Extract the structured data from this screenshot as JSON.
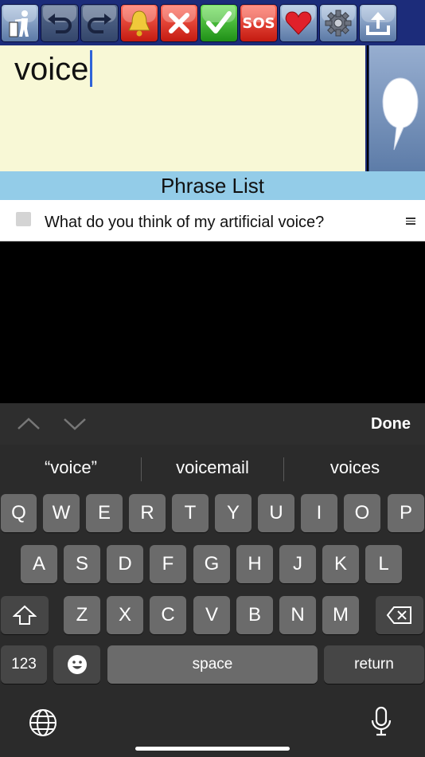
{
  "toolbar": {
    "buttons": [
      {
        "icon": "trash-person-icon"
      },
      {
        "icon": "undo-icon"
      },
      {
        "icon": "redo-icon"
      },
      {
        "icon": "bell-icon"
      },
      {
        "icon": "cancel-x-icon"
      },
      {
        "icon": "checkmark-icon"
      },
      {
        "icon": "sos-icon",
        "label": "SOS"
      },
      {
        "icon": "heart-icon"
      },
      {
        "icon": "gear-icon"
      },
      {
        "icon": "share-upload-icon"
      }
    ]
  },
  "editor": {
    "text": "voice"
  },
  "speak": {
    "icon": "speech-bubble-icon"
  },
  "phrase_list": {
    "title": "Phrase List",
    "items": [
      {
        "text": "What do you think of my artificial voice?"
      }
    ]
  },
  "keyboard": {
    "done_label": "Done",
    "suggestions": [
      "“voice”",
      "voicemail",
      "voices"
    ],
    "row1": [
      "Q",
      "W",
      "E",
      "R",
      "T",
      "Y",
      "U",
      "I",
      "O",
      "P"
    ],
    "row2": [
      "A",
      "S",
      "D",
      "F",
      "G",
      "H",
      "J",
      "K",
      "L"
    ],
    "row3": [
      "Z",
      "X",
      "C",
      "V",
      "B",
      "N",
      "M"
    ],
    "numbers_label": "123",
    "space_label": "space",
    "return_label": "return"
  },
  "colors": {
    "toolbar_bg": "#1c2c7a",
    "editor_bg": "#f8f8d6",
    "phrase_header_bg": "#93cce8",
    "caret": "#2f63d8"
  }
}
